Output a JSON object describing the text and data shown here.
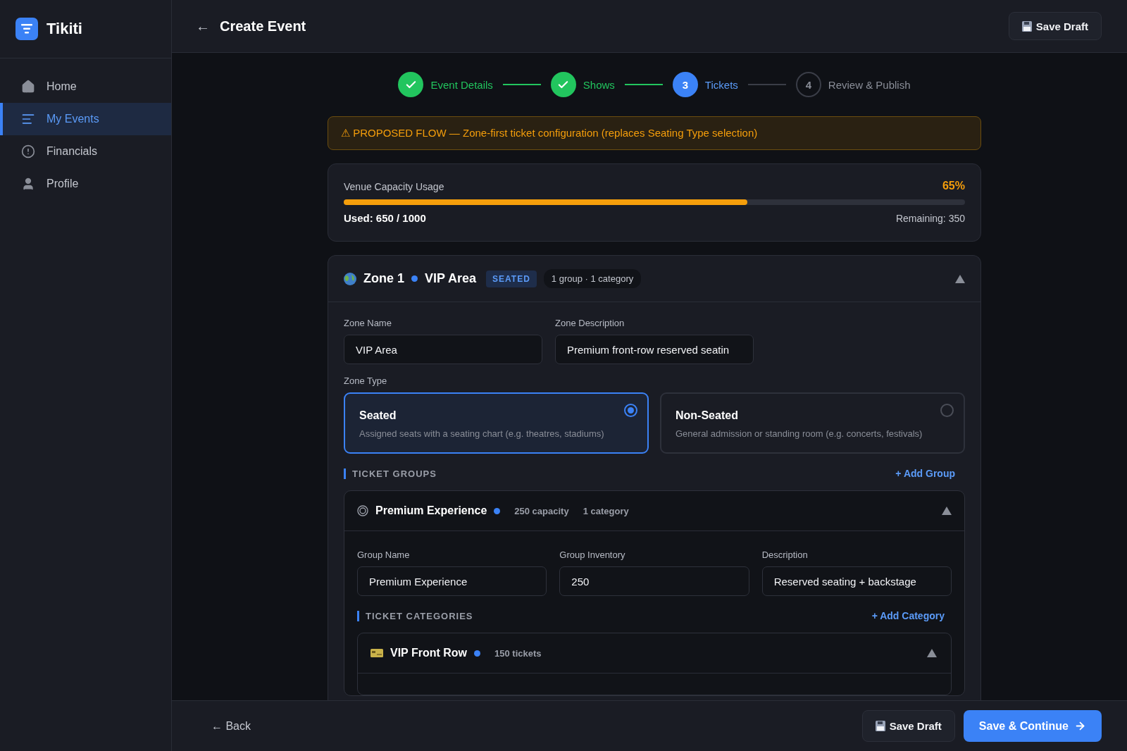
{
  "app": {
    "name": "Tikiti"
  },
  "sidebar": {
    "items": [
      {
        "label": "Home",
        "selected": false
      },
      {
        "label": "My Events",
        "selected": true
      },
      {
        "label": "Financials",
        "selected": false
      },
      {
        "label": "Profile",
        "selected": false
      }
    ]
  },
  "header": {
    "back": "←",
    "title": "Create Event",
    "save_button": "Save Draft"
  },
  "steps": [
    {
      "label": "Event Details",
      "kind": "done"
    },
    {
      "label": "Shows",
      "kind": "done"
    },
    {
      "label": "Tickets",
      "number": "3",
      "kind": "current"
    },
    {
      "label": "Review & Publish",
      "number": "4",
      "kind": "upcoming"
    }
  ],
  "banner": "⚠ PROPOSED FLOW — Zone-first ticket configuration (replaces Seating Type selection)",
  "capacity": {
    "title": "Venue Capacity Usage",
    "percent": "65%",
    "level": 0.65,
    "used": "Used: 650 / 1000",
    "remaining": "Remaining: 350"
  },
  "zone": {
    "label": "Zone 1",
    "name": "VIP Area",
    "badge": "SEATED",
    "summary": "1 group · 1 category",
    "expanded": true,
    "fields": [
      {
        "label": "Zone Name",
        "value": "VIP Area"
      },
      {
        "label": "Zone Description",
        "value": "Premium front-row reserved seatin"
      }
    ],
    "zone_type": {
      "label": "Zone Type",
      "options": [
        {
          "title": "Seated",
          "description": "Assigned seats with a seating chart (e.g. theatres, stadiums)",
          "selected": true
        },
        {
          "title": "Non-Seated",
          "description": "General admission or standing room (e.g. concerts, festivals)",
          "selected": false
        }
      ]
    },
    "ticket_groups": {
      "title": "TICKET GROUPS",
      "add": "+ Add Group",
      "groups": [
        {
          "name": "Premium Experience",
          "capacity": "250 capacity",
          "categories_count": "1 category",
          "expanded": true,
          "fields": [
            {
              "label": "Group Name",
              "value": "Premium Experience"
            },
            {
              "label": "Group Inventory",
              "value": "250"
            },
            {
              "label": "Description",
              "value": "Reserved seating + backstage"
            }
          ],
          "categories_section": {
            "title": "TICKET CATEGORIES",
            "add": "+ Add Category",
            "categories": [
              {
                "name": "VIP Front Row",
                "tickets": "150 tickets",
                "expanded": true
              }
            ]
          }
        }
      ]
    }
  },
  "footer": {
    "back": "← Back",
    "save": "Save Draft",
    "continue": "Save & Continue"
  }
}
